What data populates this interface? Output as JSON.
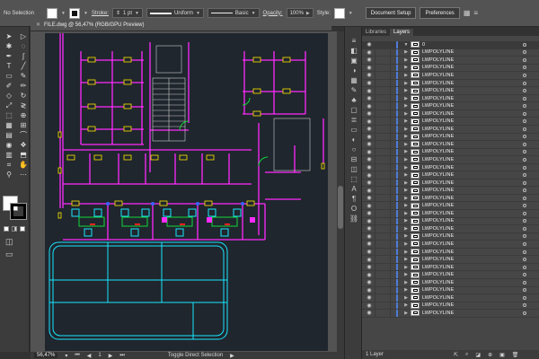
{
  "control": {
    "selection": "No Selection",
    "stroke_label": "Stroke:",
    "stroke_weight": "1 pt",
    "profile": "Uniform",
    "brush": "Basic",
    "opacity_label": "Opacity:",
    "opacity": "100%",
    "style_label": "Style:",
    "doc_setup": "Document Setup",
    "preferences": "Preferences"
  },
  "document": {
    "tab_title": "FILE.dwg @ 56,47% (RGB/GPU Preview)",
    "zoom": "56,47%",
    "page": "1",
    "status_text": "Toggle Direct Selection"
  },
  "panel": {
    "tab_libraries": "Libraries",
    "tab_layers": "Layers",
    "layer_name": "0",
    "item_name": "LWPOLYLINE",
    "item_count": 35,
    "footer": "1 Layer"
  },
  "colors": {
    "canvas_bg": "#1f262d",
    "walls_magenta": "#ff2bff",
    "yellow": "#ffe800",
    "cyan": "#19e6ff",
    "white": "#e6e6e6",
    "green": "#13d83b",
    "red": "#ff2020",
    "blue": "#3a63ff",
    "layer_accent": "#4e7bd6"
  },
  "icons": {
    "tools": [
      "selection-icon",
      "direct-selection-icon",
      "magic-wand-icon",
      "lasso-icon",
      "pen-icon",
      "curvature-icon",
      "type-icon",
      "line-segment-icon",
      "rectangle-icon",
      "paintbrush-icon",
      "shaper-icon",
      "pencil-icon",
      "eraser-icon",
      "rotate-icon",
      "scale-icon",
      "width-icon",
      "free-transform-icon",
      "shape-builder-icon",
      "perspective-grid-icon",
      "mesh-icon",
      "gradient-icon",
      "eyedropper-icon",
      "blend-icon",
      "symbol-sprayer-icon",
      "column-graph-icon",
      "artboard-icon",
      "slice-icon",
      "hand-icon",
      "zoom-icon"
    ],
    "dock": [
      "properties-icon",
      "layers-icon",
      "libraries-icon",
      "color-icon",
      "swatches-icon",
      "brushes-icon",
      "symbols-icon",
      "graphic-styles-icon",
      "stroke-icon",
      "gradient-icon",
      "transparency-icon",
      "appearance-icon",
      "align-icon",
      "pathfinder-icon",
      "transform-icon",
      "character-icon",
      "paragraph-icon",
      "opentype-icon",
      "links-icon"
    ]
  }
}
